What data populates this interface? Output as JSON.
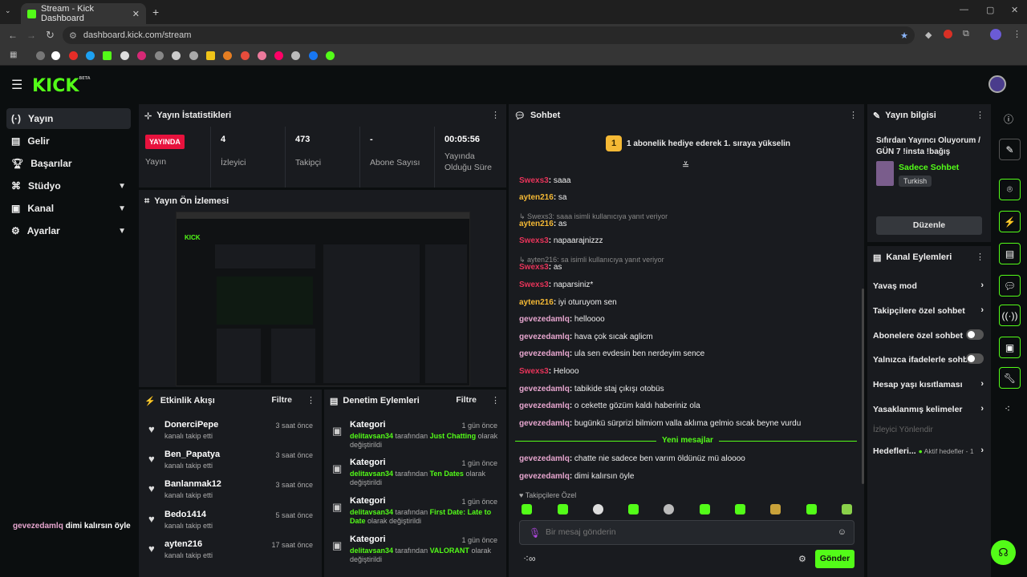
{
  "browser": {
    "tab_title": "Stream - Kick Dashboard",
    "url": "dashboard.kick.com/stream"
  },
  "brand": {
    "logo": "KICK",
    "beta": "BETA"
  },
  "sidebar": {
    "items": [
      {
        "label": "Yayın",
        "icon": "broadcast-icon"
      },
      {
        "label": "Gelir",
        "icon": "revenue-icon"
      },
      {
        "label": "Başarılar",
        "icon": "trophy-icon"
      },
      {
        "label": "Stüdyo",
        "icon": "studio-icon"
      },
      {
        "label": "Kanal",
        "icon": "channel-icon"
      },
      {
        "label": "Ayarlar",
        "icon": "gear-icon"
      }
    ],
    "footer_user": "gevezedamlq",
    "footer_msg": "dimi kalırsın öyle"
  },
  "stats": {
    "title": "Yayın İstatistikleri",
    "live_badge": "YAYINDA",
    "live_label": "Yayın",
    "viewers": "4",
    "viewers_label": "İzleyici",
    "followers": "473",
    "followers_label": "Takipçi",
    "subs": "-",
    "subs_label": "Abone Sayısı",
    "duration": "00:05:56",
    "duration_label": "Yayında Olduğu Süre"
  },
  "preview": {
    "title": "Yayın Ön İzlemesi"
  },
  "events": {
    "title": "Etkinlik Akışı",
    "filter": "Filtre",
    "items": [
      {
        "name": "DonerciPepe",
        "sub": "kanalı takip etti",
        "time": "3 saat önce"
      },
      {
        "name": "Ben_Papatya",
        "sub": "kanalı takip etti",
        "time": "3 saat önce"
      },
      {
        "name": "Banlanmak12",
        "sub": "kanalı takip etti",
        "time": "3 saat önce"
      },
      {
        "name": "Bedo1414",
        "sub": "kanalı takip etti",
        "time": "5 saat önce"
      },
      {
        "name": "ayten216",
        "sub": "kanalı takip etti",
        "time": "17 saat önce"
      }
    ]
  },
  "moderation": {
    "title": "Denetim Eylemleri",
    "filter": "Filtre",
    "items": [
      {
        "title": "Kategori",
        "time": "1 gün önce",
        "user": "delitavsan34",
        "mid": "tarafından",
        "value": "Just Chatting",
        "end": "olarak değiştirildi"
      },
      {
        "title": "Kategori",
        "time": "1 gün önce",
        "user": "delitavsan34",
        "mid": "tarafından",
        "value": "Ten Dates",
        "end": "olarak değiştirildi"
      },
      {
        "title": "Kategori",
        "time": "1 gün önce",
        "user": "delitavsan34",
        "mid": "tarafından",
        "value": "First Date: Late to Date",
        "end": "olarak değiştirildi"
      },
      {
        "title": "Kategori",
        "time": "1 gün önce",
        "user": "delitavsan34",
        "mid": "tarafından",
        "value": "VALORANT",
        "end": "olarak değiştirildi"
      }
    ]
  },
  "chat": {
    "title": "Sohbet",
    "pinned": "1 abonelik hediye ederek 1. sıraya yükselin",
    "pinned_rank": "1",
    "messages": [
      {
        "user": "Swexs3",
        "color": "#e8345a",
        "text": "saaa"
      },
      {
        "user": "ayten216",
        "color": "#f5b935",
        "text": "sa"
      },
      {
        "reply": "Swexs3: saaa isimli kullanıcıya yanıt veriyor"
      },
      {
        "user": "ayten216",
        "color": "#f5b935",
        "text": "as"
      },
      {
        "user": "Swexs3",
        "color": "#e8345a",
        "text": "napaarajnizzz"
      },
      {
        "reply": "ayten216: sa isimli kullanıcıya yanıt veriyor"
      },
      {
        "user": "Swexs3",
        "color": "#e8345a",
        "text": "as"
      },
      {
        "user": "Swexs3",
        "color": "#e8345a",
        "text": "naparsiniz*"
      },
      {
        "user": "ayten216",
        "color": "#f5b935",
        "text": "iyi oturuyom sen"
      },
      {
        "user": "gevezedamlq",
        "color": "#e7a6cf",
        "text": "helloooo"
      },
      {
        "user": "gevezedamlq",
        "color": "#e7a6cf",
        "text": "hava çok sıcak aglicm"
      },
      {
        "user": "gevezedamlq",
        "color": "#e7a6cf",
        "text": "ula sen evdesin ben nerdeyim sence"
      },
      {
        "user": "Swexs3",
        "color": "#e8345a",
        "text": "Helooo"
      },
      {
        "user": "gevezedamlq",
        "color": "#e7a6cf",
        "text": "tabikide staj çıkışı otobüs"
      },
      {
        "user": "gevezedamlq",
        "color": "#e7a6cf",
        "text": "o cekette gözüm kaldı haberiniz ola"
      },
      {
        "user": "gevezedamlq",
        "color": "#e7a6cf",
        "text": "bugünkü sürprizi bilmiom valla aklıma gelmio sıcak beyne vurdu"
      }
    ],
    "new_label": "Yeni mesajlar",
    "new_messages": [
      {
        "user": "gevezedamlq",
        "color": "#e7a6cf",
        "text": "chatte nie sadece ben varım öldünüz mü aloooo"
      },
      {
        "user": "gevezedamlq",
        "color": "#e7a6cf",
        "text": "dimi kalırsın öyle"
      }
    ],
    "followers_only": "Takipçilere Özel",
    "input_placeholder": "Bir mesaj gönderin",
    "send": "Gönder"
  },
  "stream_info": {
    "title": "Yayın bilgisi",
    "stream_title": "Sıfırdan Yayıncı Oluyorum / GÜN 7 !insta !bağış",
    "category": "Sadece Sohbet",
    "language": "Turkish",
    "edit": "Düzenle"
  },
  "channel_actions": {
    "title": "Kanal Eylemleri",
    "items": [
      {
        "label": "Yavaş mod",
        "type": "arrow"
      },
      {
        "label": "Takipçilere özel sohbet",
        "type": "arrow"
      },
      {
        "label": "Abonelere özel sohbet",
        "type": "toggle"
      },
      {
        "label": "Yalnızca ifadelerle sohbet",
        "type": "toggle"
      },
      {
        "label": "Hesap yaşı kısıtlaması",
        "type": "arrow"
      },
      {
        "label": "Yasaklanmış kelimeler",
        "type": "arrow"
      }
    ],
    "disabled_item": "İzleyici Yönlendir",
    "goals": "Hedefleri...",
    "goals_status": "Aktif hedefler - 1"
  },
  "colors": {
    "accent": "#53fc18",
    "panel": "#191b1f",
    "bg": "#0b0e0f"
  }
}
